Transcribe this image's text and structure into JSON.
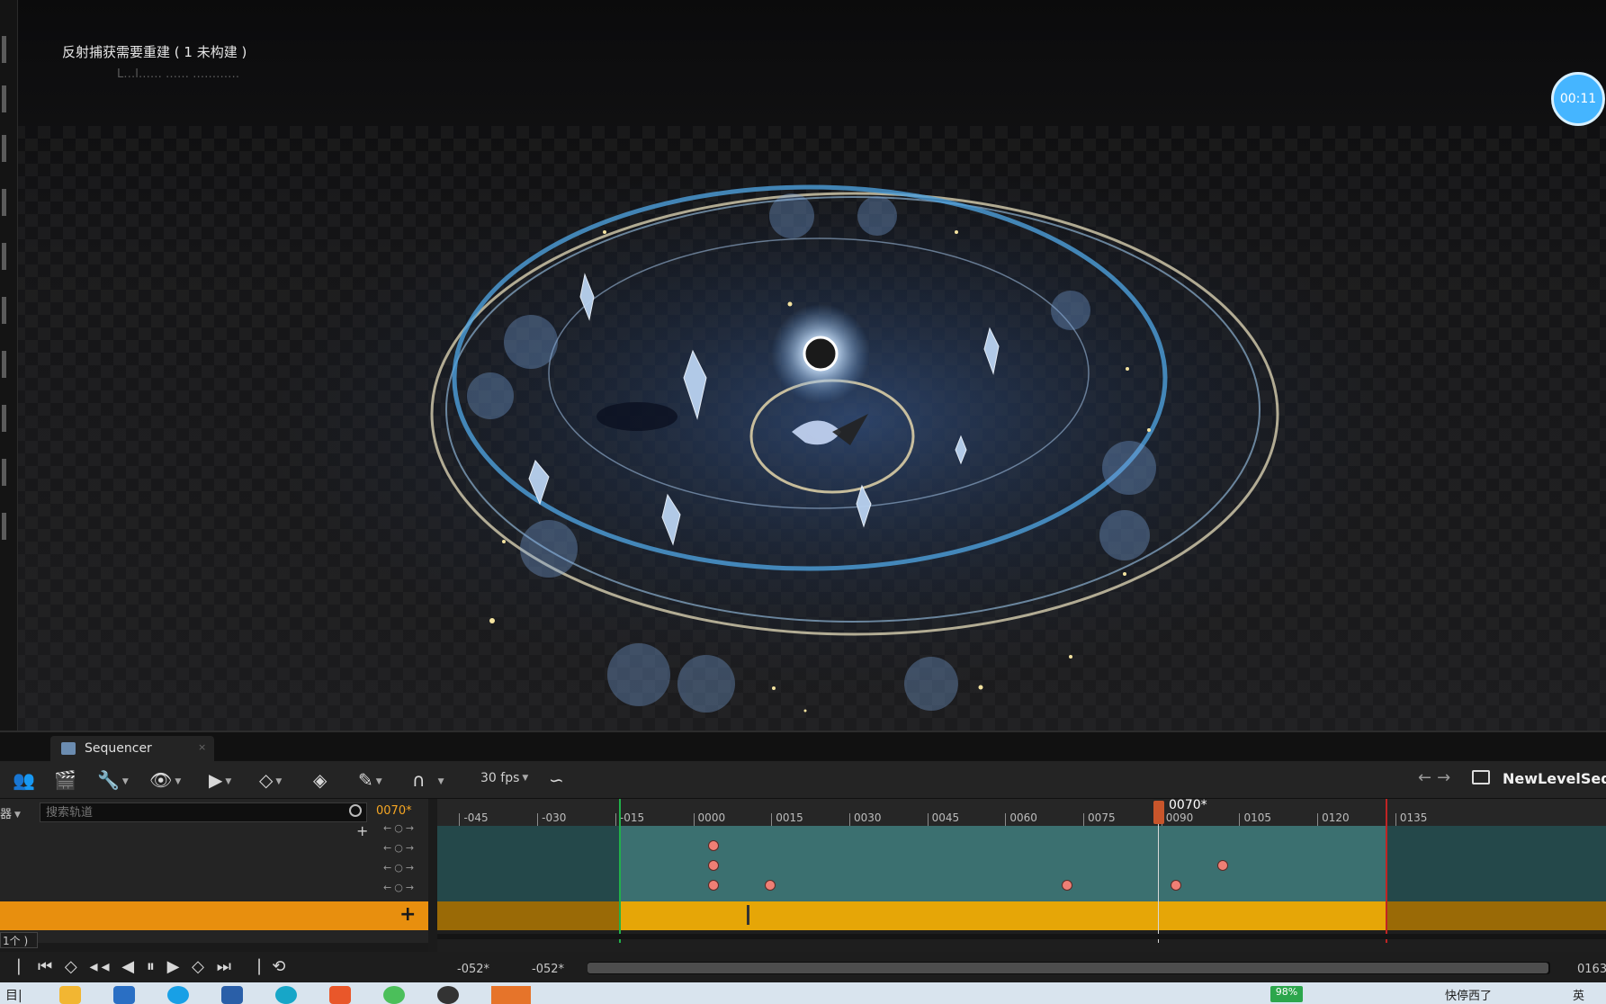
{
  "viewport": {
    "warning": "反射捕获需要重建 ( 1 未构建 )",
    "ghost_line": "L…l…… …… …………",
    "timer": "00:11"
  },
  "sequencer": {
    "tab_label": "Sequencer",
    "tab_close": "×",
    "fps": "30 fps",
    "sequence_name": "NewLevelSequ",
    "filter_label": "器",
    "search_placeholder": "搜索轨道",
    "current_frame": "0070*",
    "playhead_label": "0070*",
    "count_tag": "1个 )",
    "ruler_ticks": [
      "-045",
      "-030",
      "-015",
      "0000",
      "0015",
      "0030",
      "0045",
      "0060",
      "0075",
      "0090",
      "0105",
      "0120",
      "0135"
    ],
    "range_in": "-052*",
    "range_out": "-052*",
    "range_end": "0163",
    "row_controls": "←○→",
    "add": "+",
    "keyframes": [
      {
        "row": 0,
        "frame": 0
      },
      {
        "row": 1,
        "frame": 0
      },
      {
        "row": 1,
        "frame": 98
      },
      {
        "row": 2,
        "frame": 0
      },
      {
        "row": 2,
        "frame": 11
      },
      {
        "row": 2,
        "frame": 68
      },
      {
        "row": 2,
        "frame": 89
      }
    ]
  },
  "taskbar": {
    "battery": "98%",
    "tray_text": "快停西了",
    "ime": "英",
    "start": "目|"
  },
  "colors": {
    "accent_orange": "#e88f0e",
    "section_yellow": "#e6a607",
    "playhead": "#c8552b",
    "key": "#ef7f75",
    "start_marker": "#21b04a",
    "end_marker": "#c02424"
  },
  "icons": [
    "add-actor-icon",
    "clapper-icon",
    "wrench-icon",
    "eye-icon",
    "play-icon",
    "key-icon",
    "auto-key-icon",
    "pencil-icon",
    "magnet-icon",
    "curve-icon",
    "folder-icon",
    "search-icon"
  ]
}
